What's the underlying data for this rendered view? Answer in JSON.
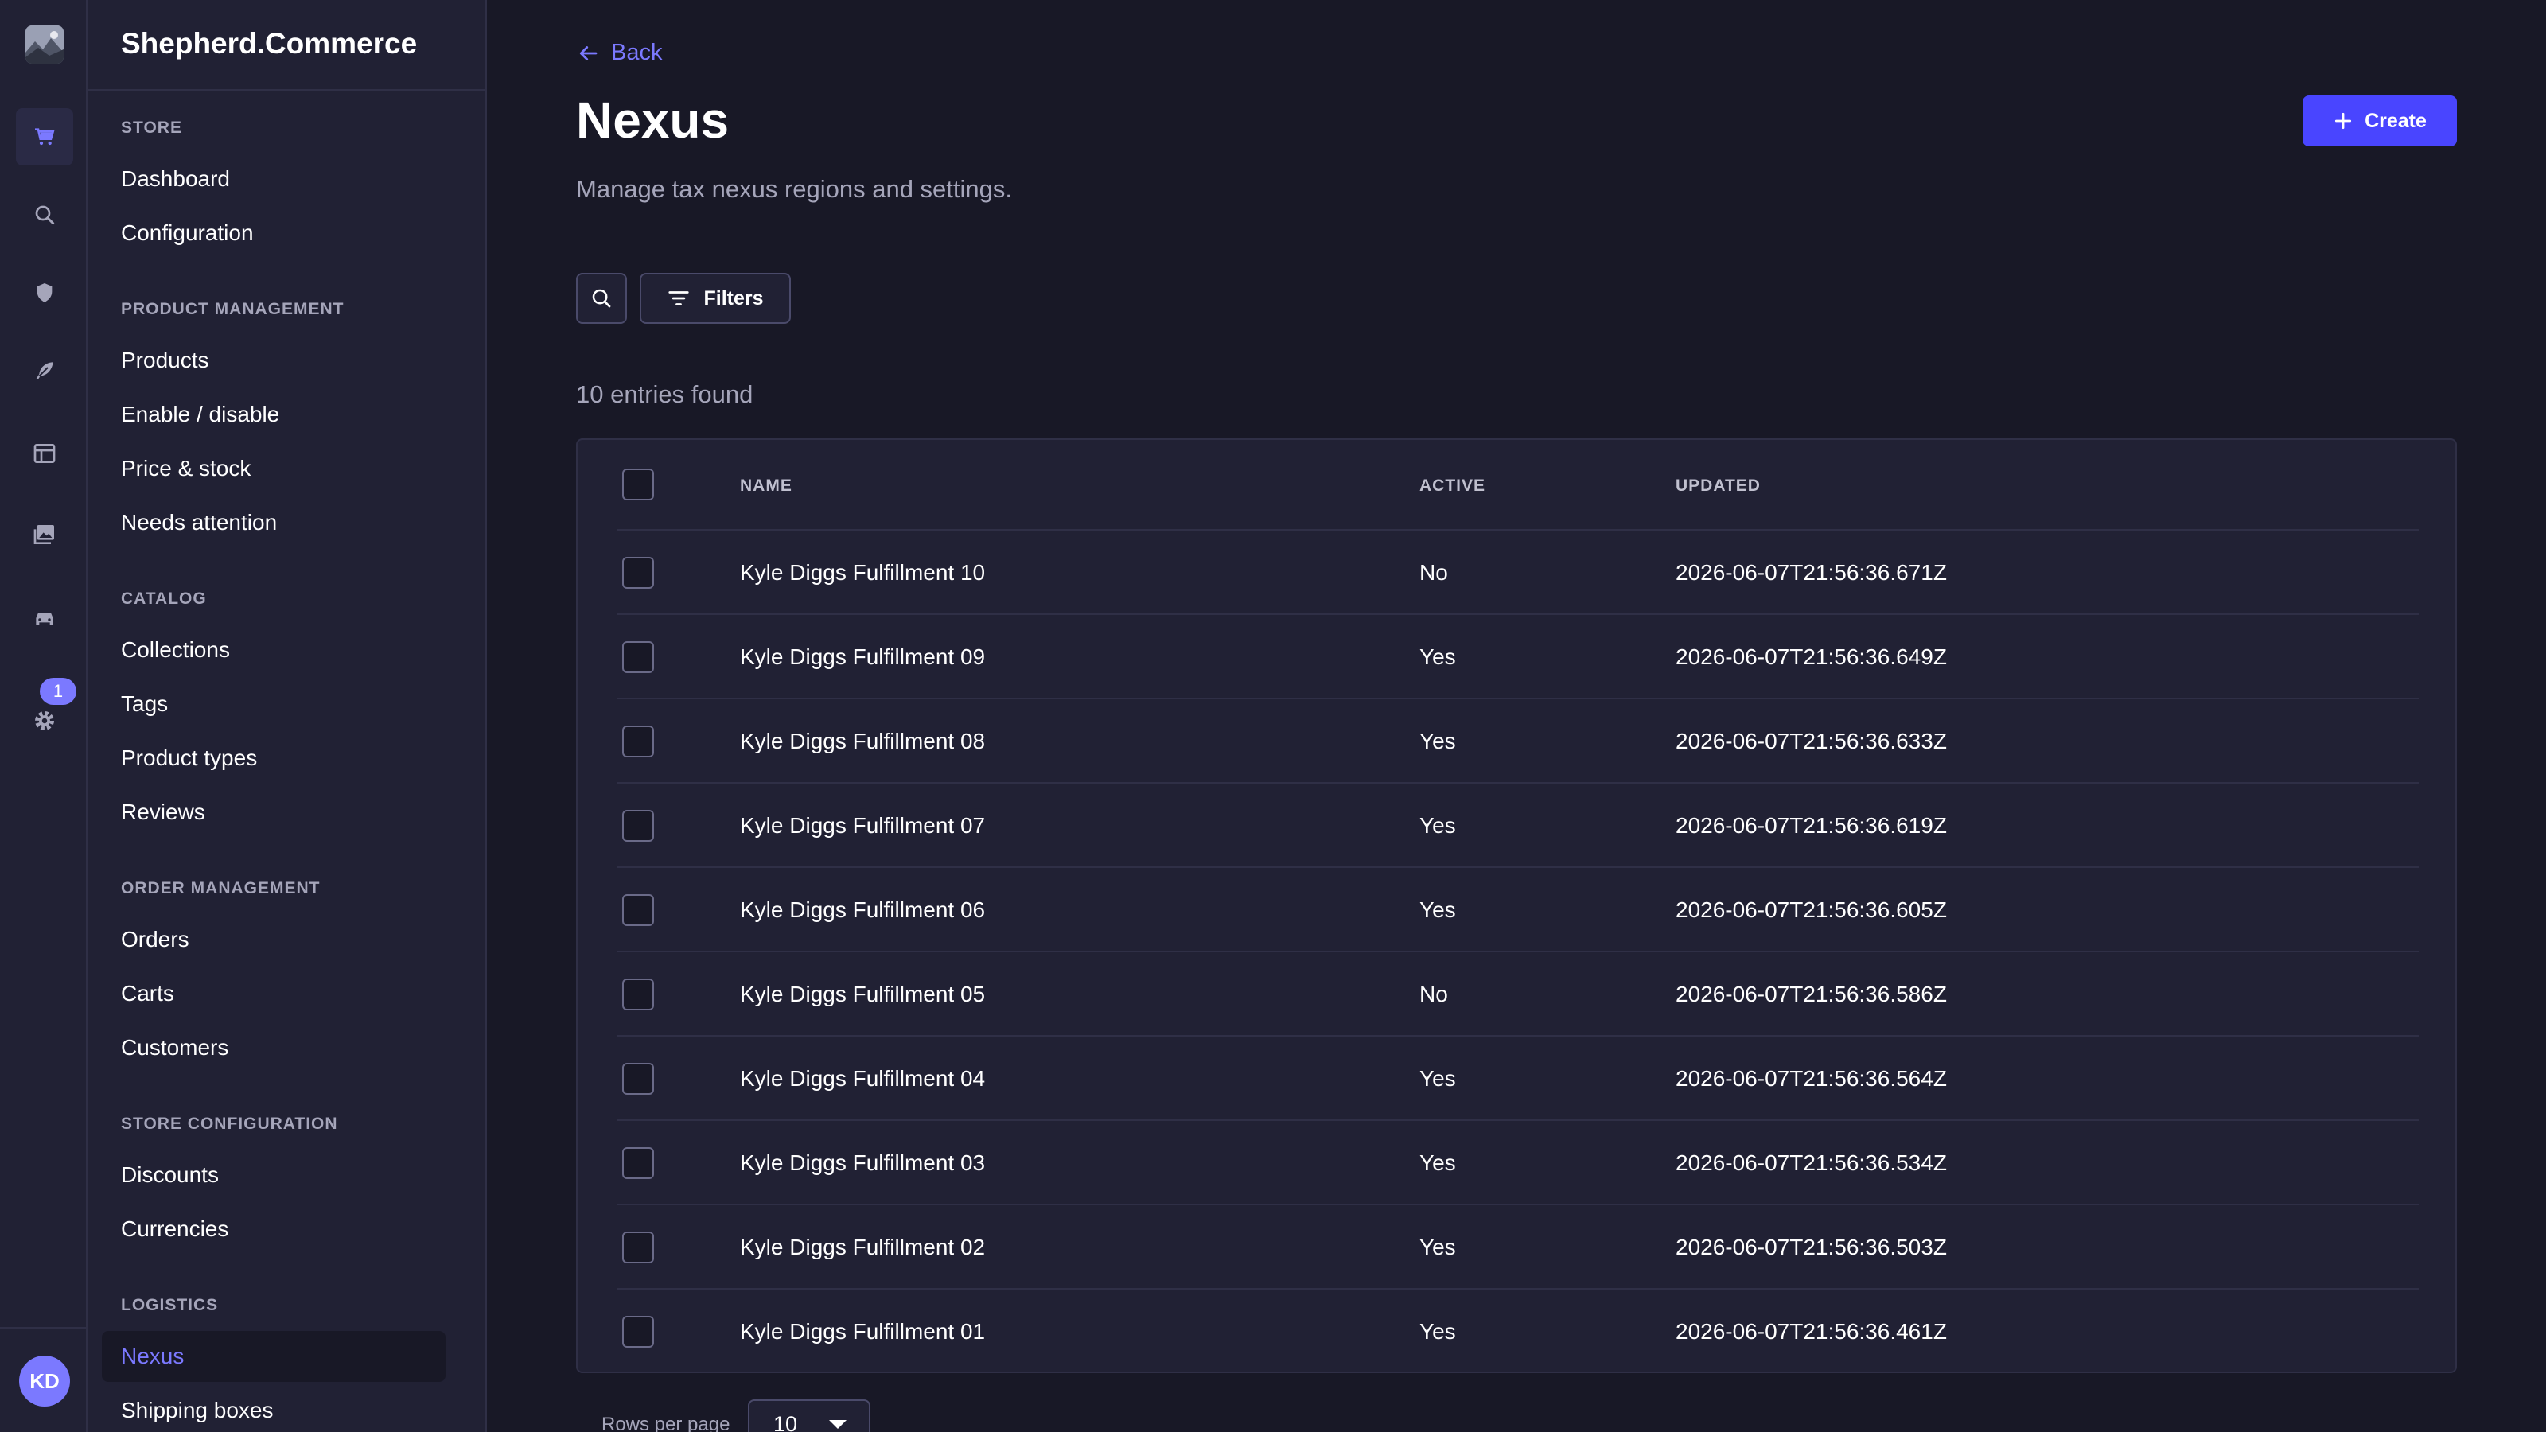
{
  "app": {
    "brand": "Shepherd.Commerce"
  },
  "rail": {
    "logo_icon": "store-logo-icon",
    "items": [
      {
        "icon": "cart-icon",
        "active": true
      },
      {
        "icon": "search-icon",
        "active": false
      },
      {
        "icon": "shield-icon",
        "active": false
      },
      {
        "icon": "feather-icon",
        "active": false
      },
      {
        "icon": "layout-icon",
        "active": false
      },
      {
        "icon": "images-icon",
        "active": false
      },
      {
        "icon": "car-icon",
        "active": false
      },
      {
        "icon": "gear-icon",
        "active": false
      }
    ],
    "settings_badge": "1",
    "avatar_initials": "KD"
  },
  "subnav": {
    "sections": [
      {
        "title": "Store",
        "items": [
          "Dashboard",
          "Configuration"
        ]
      },
      {
        "title": "Product management",
        "items": [
          "Products",
          "Enable / disable",
          "Price & stock",
          "Needs attention"
        ]
      },
      {
        "title": "Catalog",
        "items": [
          "Collections",
          "Tags",
          "Product types",
          "Reviews"
        ]
      },
      {
        "title": "Order management",
        "items": [
          "Orders",
          "Carts",
          "Customers"
        ]
      },
      {
        "title": "Store configuration",
        "items": [
          "Discounts",
          "Currencies"
        ]
      },
      {
        "title": "Logistics",
        "items": [
          "Nexus",
          "Shipping boxes"
        ]
      }
    ],
    "active_item": "Nexus"
  },
  "header": {
    "back_label": "Back",
    "title": "Nexus",
    "subtitle": "Manage tax nexus regions and settings.",
    "create_label": "Create"
  },
  "toolbar": {
    "filters_label": "Filters"
  },
  "entries_text": "10 entries found",
  "table": {
    "columns": [
      "Name",
      "Active",
      "Updated"
    ],
    "rows": [
      {
        "name": "Kyle Diggs Fulfillment 10",
        "active": "No",
        "updated": "2026-06-07T21:56:36.671Z"
      },
      {
        "name": "Kyle Diggs Fulfillment 09",
        "active": "Yes",
        "updated": "2026-06-07T21:56:36.649Z"
      },
      {
        "name": "Kyle Diggs Fulfillment 08",
        "active": "Yes",
        "updated": "2026-06-07T21:56:36.633Z"
      },
      {
        "name": "Kyle Diggs Fulfillment 07",
        "active": "Yes",
        "updated": "2026-06-07T21:56:36.619Z"
      },
      {
        "name": "Kyle Diggs Fulfillment 06",
        "active": "Yes",
        "updated": "2026-06-07T21:56:36.605Z"
      },
      {
        "name": "Kyle Diggs Fulfillment 05",
        "active": "No",
        "updated": "2026-06-07T21:56:36.586Z"
      },
      {
        "name": "Kyle Diggs Fulfillment 04",
        "active": "Yes",
        "updated": "2026-06-07T21:56:36.564Z"
      },
      {
        "name": "Kyle Diggs Fulfillment 03",
        "active": "Yes",
        "updated": "2026-06-07T21:56:36.534Z"
      },
      {
        "name": "Kyle Diggs Fulfillment 02",
        "active": "Yes",
        "updated": "2026-06-07T21:56:36.503Z"
      },
      {
        "name": "Kyle Diggs Fulfillment 01",
        "active": "Yes",
        "updated": "2026-06-07T21:56:36.461Z"
      }
    ]
  },
  "pagination": {
    "rows_per_page_label": "Rows per page",
    "rows_per_page_value": "10"
  },
  "colors": {
    "accent": "#7b79ff",
    "primary_button": "#4945ff",
    "background": "#181826",
    "surface": "#212134",
    "muted_text": "#a5a5ba"
  }
}
